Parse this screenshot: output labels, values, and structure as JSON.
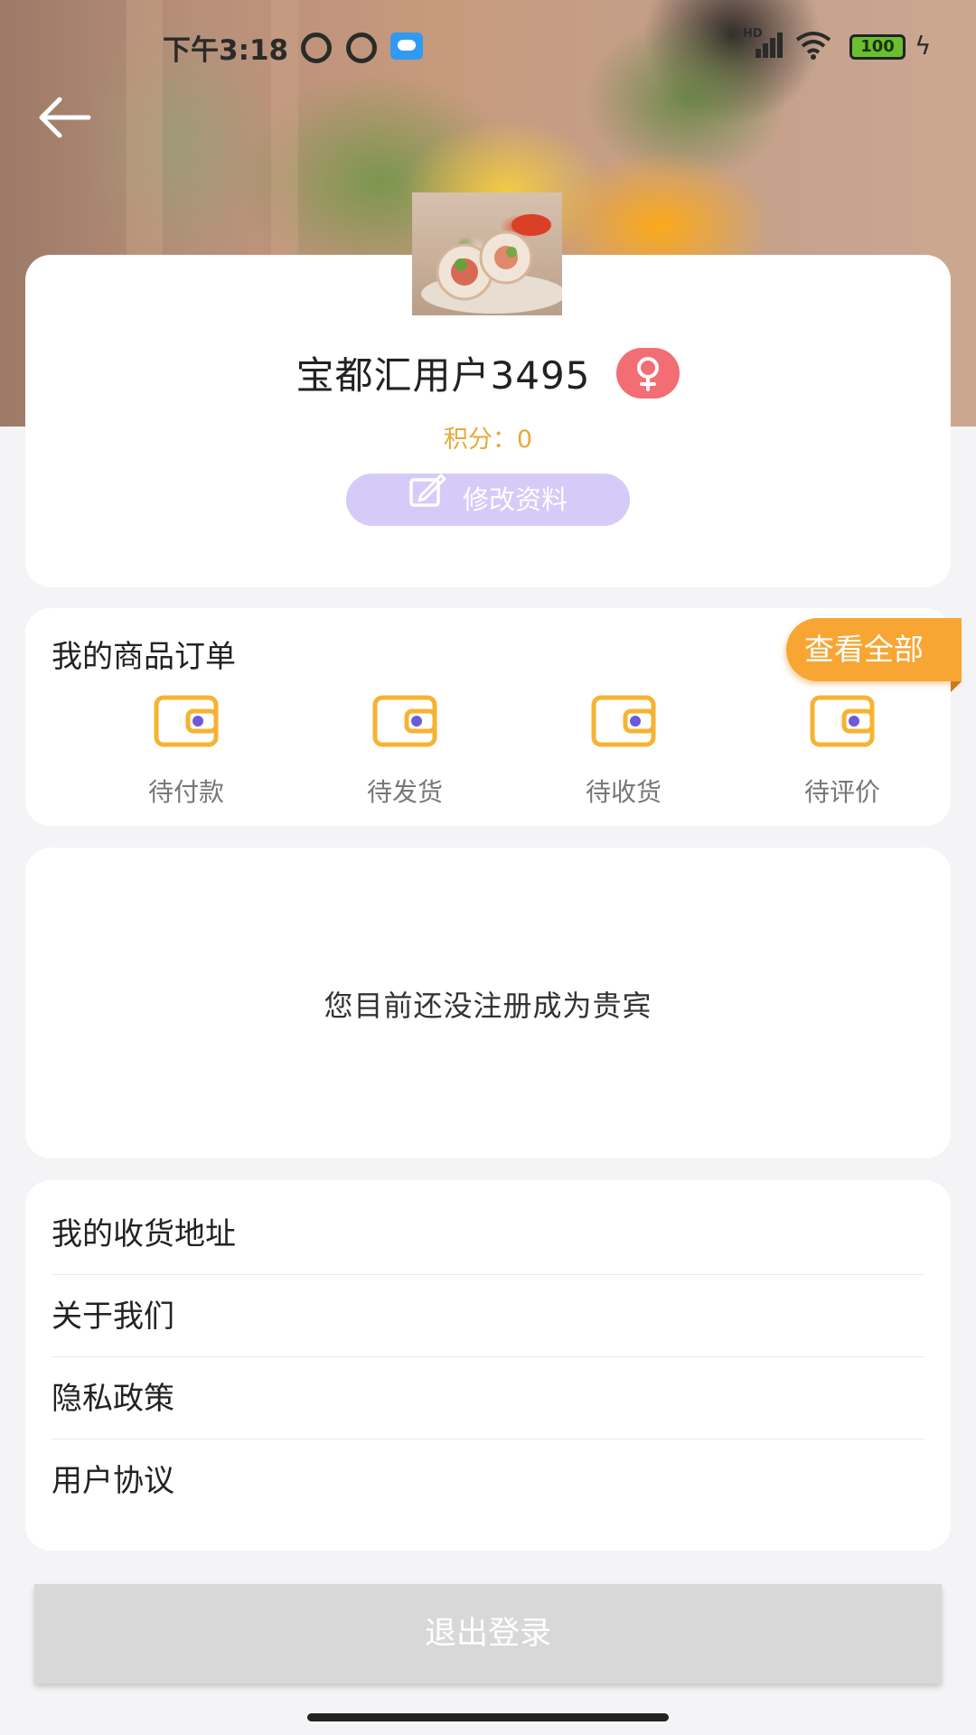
{
  "status_bar": {
    "time": "下午3:18",
    "battery": "100",
    "network": "HD"
  },
  "profile": {
    "username": "宝都汇用户3495",
    "gender_icon": "female-icon",
    "points_text": "积分：0",
    "edit_label": "修改资料"
  },
  "orders": {
    "title": "我的商品订单",
    "view_all": "查看全部",
    "items": [
      {
        "label": "待付款",
        "icon": "wallet-icon"
      },
      {
        "label": "待发货",
        "icon": "wallet-icon"
      },
      {
        "label": "待收货",
        "icon": "wallet-icon"
      },
      {
        "label": "待评价",
        "icon": "wallet-icon"
      }
    ]
  },
  "vip": {
    "message": "您目前还没注册成为贵宾"
  },
  "menu": {
    "items": [
      "我的收货地址",
      "关于我们",
      "隐私政策",
      "用户协议"
    ]
  },
  "logout_label": "退出登录",
  "colors": {
    "points": "#e6a93b",
    "edit_button": "#d6cbf8",
    "gender_badge": "#f26d74",
    "view_all": "#f7a634",
    "wallet_icon": "#f6b332",
    "wallet_eye": "#6b5ad9",
    "logout": "#d8d8d8"
  }
}
